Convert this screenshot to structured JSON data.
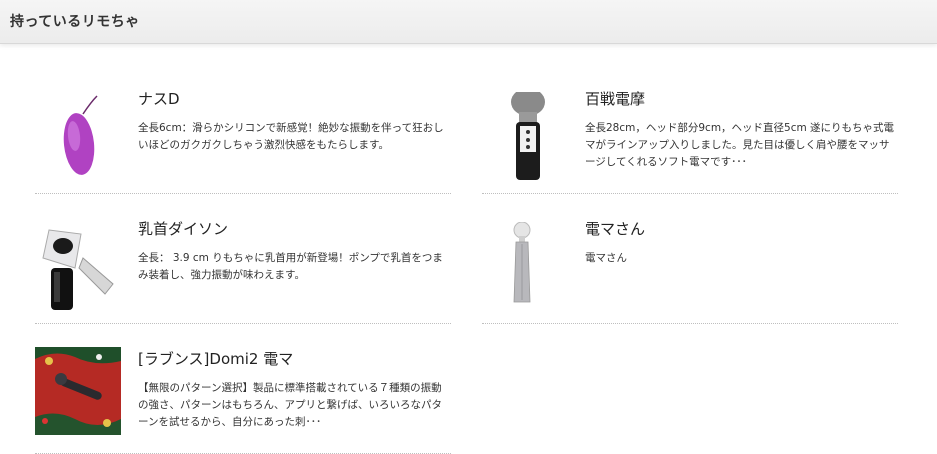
{
  "header": {
    "title": "持っているリモちゃ"
  },
  "items": [
    {
      "name": "ナスD",
      "description": "全長6cm：滑らかシリコンで新感覚！絶妙な振動を伴って狂おしいほどのガクガクしちゃう激烈快感をもたらします。",
      "image_icon": "purple-egg-vibrator"
    },
    {
      "name": "百戦電摩",
      "description": "全長28cm，ヘッド部分9cm，ヘッド直径5cm 遂にりもちゃ式電マがラインアップ入りしました。見た目は優しく肩や腰をマッサージしてくれるソフト電マです･･･",
      "image_icon": "wand-massager"
    },
    {
      "name": "乳首ダイソン",
      "description": "全長： 3.9 cm りもちゃに乳首用が新登場！ポンプで乳首をつまみ装着し、強力振動が味わえます。",
      "image_icon": "nipple-suction-device"
    },
    {
      "name": "電マさん",
      "description": "電マさん",
      "image_icon": "grey-wand-massager"
    },
    {
      "name": "[ラブンス]Domi2 電マ",
      "description": "【無限のパターン選択】製品に標準搭載されている７種類の振動の強さ、パターンはもちろん、アプリと繋げば、いろいろなパターンを試せるから、自分にあった刺･･･",
      "image_icon": "christmas-wand-photo"
    }
  ],
  "colors": {
    "header_bg": "#efefef",
    "divider": "#bfbfbf",
    "text": "#222222"
  }
}
